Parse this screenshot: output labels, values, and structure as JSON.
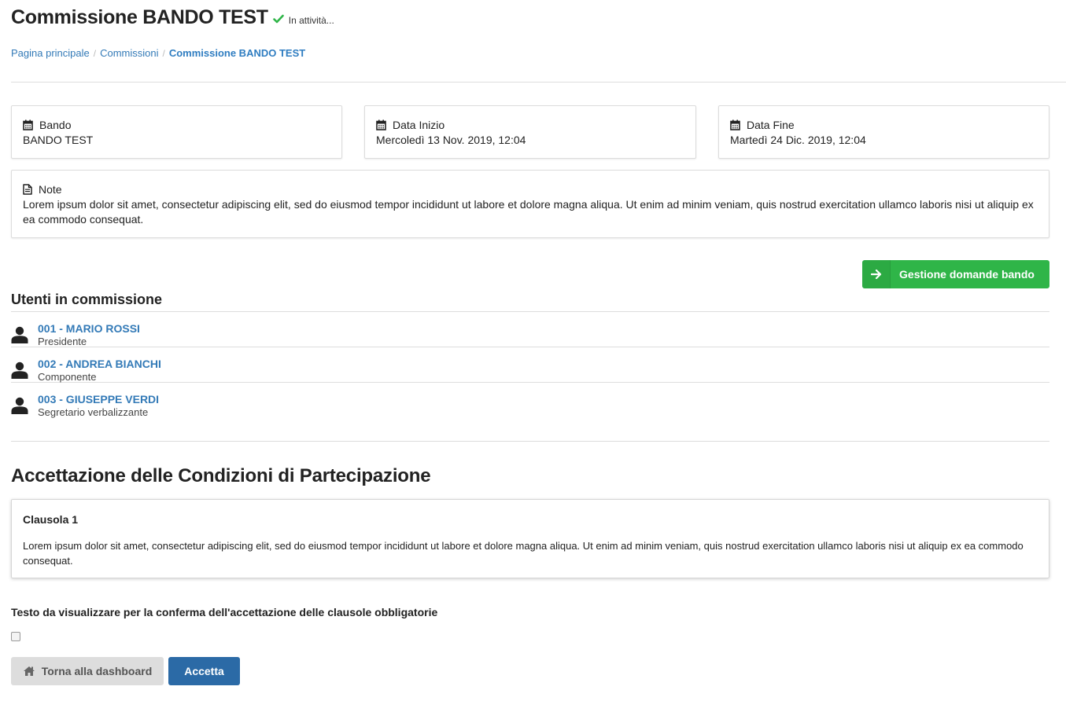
{
  "header": {
    "title": "Commissione BANDO TEST",
    "status_text": "In attività...",
    "status_icon": "check-icon",
    "status_color": "#2fb548"
  },
  "breadcrumb": {
    "items": [
      "Pagina principale",
      "Commissioni"
    ],
    "current": "Commissione BANDO TEST",
    "separator": "/"
  },
  "info_cards": {
    "bando": {
      "label": "Bando",
      "value": "BANDO TEST",
      "icon": "calendar-icon"
    },
    "data_inizio": {
      "label": "Data Inizio",
      "value": "Mercoledì 13 Nov. 2019, 12:04",
      "icon": "calendar-icon"
    },
    "data_fine": {
      "label": "Data Fine",
      "value": "Martedì 24 Dic. 2019, 12:04",
      "icon": "calendar-icon"
    },
    "note": {
      "label": "Note",
      "icon": "file-icon",
      "value": "Lorem ipsum dolor sit amet, consectetur adipiscing elit, sed do eiusmod tempor incididunt ut labore et dolore magna aliqua. Ut enim ad minim veniam, quis nostrud exercitation ullamco laboris nisi ut aliquip ex ea commodo consequat."
    }
  },
  "actions": {
    "manage_label": "Gestione domande bando",
    "manage_color": "#2fb548"
  },
  "users_section": {
    "title": "Utenti in commissione",
    "users": [
      {
        "name": "001 - MARIO ROSSI",
        "role": "Presidente"
      },
      {
        "name": "002 - ANDREA BIANCHI",
        "role": "Componente"
      },
      {
        "name": "003 - GIUSEPPE VERDI",
        "role": "Segretario verbalizzante"
      }
    ]
  },
  "conditions": {
    "title": "Accettazione delle Condizioni di Partecipazione",
    "clauses": [
      {
        "title": "Clausola 1",
        "text": "Lorem ipsum dolor sit amet, consectetur adipiscing elit, sed do eiusmod tempor incididunt ut labore et dolore magna aliqua. Ut enim ad minim veniam, quis nostrud exercitation ullamco laboris nisi ut aliquip ex ea commodo consequat."
      }
    ],
    "confirm_text": "Testo da visualizzare per la conferma dell'accettazione delle clausole obbligatorie",
    "checkbox_checked": false
  },
  "footer": {
    "back_label": "Torna alla dashboard",
    "accept_label": "Accetta",
    "accept_color": "#2b6aa6"
  }
}
